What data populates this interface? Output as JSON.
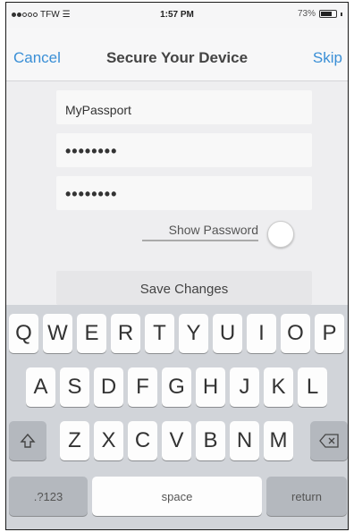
{
  "status_bar": {
    "carrier": "TFW",
    "time": "1:57 PM",
    "battery": "73%"
  },
  "nav": {
    "cancel": "Cancel",
    "title": "Secure Your Device",
    "skip": "Skip"
  },
  "form": {
    "device_name": "MyPassport",
    "password": "••••••••",
    "confirm_password": "••••••••",
    "show_password_label": "Show Password",
    "show_password_on": false,
    "save_label": "Save Changes"
  },
  "keyboard": {
    "row1": [
      "Q",
      "W",
      "E",
      "R",
      "T",
      "Y",
      "U",
      "I",
      "O",
      "P"
    ],
    "row2": [
      "A",
      "S",
      "D",
      "F",
      "G",
      "H",
      "J",
      "K",
      "L"
    ],
    "row3": [
      "Z",
      "X",
      "C",
      "V",
      "B",
      "N",
      "M"
    ],
    "numbers_label": ".?123",
    "space_label": "space",
    "return_label": "return"
  },
  "colors": {
    "accent": "#3a8fd6",
    "keyboard_bg": "#d1d4d9"
  }
}
